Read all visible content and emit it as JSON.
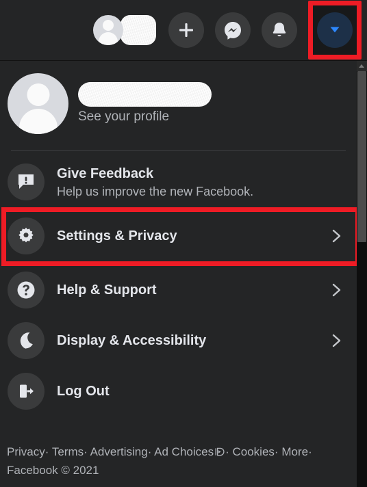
{
  "app": {
    "title": "Facebook account dropdown menu"
  },
  "topbar": {
    "profile_chip": {
      "name_redacted": true,
      "avatar": "user-avatar-icon"
    },
    "buttons": [
      {
        "name": "create-button",
        "icon": "plus-icon",
        "label": "Create"
      },
      {
        "name": "messenger-button",
        "icon": "messenger-icon",
        "label": "Messenger"
      },
      {
        "name": "notifications-button",
        "icon": "bell-icon",
        "label": "Notifications"
      },
      {
        "name": "account-dropdown-button",
        "icon": "chevron-down-triangle-icon",
        "label": "Account",
        "active": true,
        "highlighted": true
      }
    ]
  },
  "panel": {
    "profile": {
      "name_redacted": true,
      "see_profile_label": "See your profile",
      "avatar_icon": "user-avatar-icon"
    },
    "items": [
      {
        "id": "give-feedback",
        "icon": "feedback-bubble-icon",
        "title": "Give Feedback",
        "subtitle": "Help us improve the new Facebook.",
        "chevron": false,
        "highlighted": false
      },
      {
        "id": "settings-privacy",
        "icon": "gear-icon",
        "title": "Settings & Privacy",
        "subtitle": "",
        "chevron": true,
        "highlighted": true
      },
      {
        "id": "help-support",
        "icon": "question-mark-icon",
        "title": "Help & Support",
        "subtitle": "",
        "chevron": true,
        "highlighted": false
      },
      {
        "id": "display-accessibility",
        "icon": "moon-icon",
        "title": "Display & Accessibility",
        "subtitle": "",
        "chevron": true,
        "highlighted": false
      },
      {
        "id": "log-out",
        "icon": "logout-door-icon",
        "title": "Log Out",
        "subtitle": "",
        "chevron": false,
        "highlighted": false
      }
    ],
    "footer": {
      "links": [
        "Privacy",
        "Terms",
        "Advertising",
        "Ad Choices",
        "Cookies",
        "More"
      ],
      "separator": "·",
      "adchoices_icon": "adchoices-icon",
      "copyright": "Facebook © 2021"
    },
    "scrollbar": {
      "present": true,
      "arrow": "scroll-up-arrow-icon"
    }
  },
  "colors": {
    "panel_background": "#242526",
    "topbar_background": "#242526",
    "page_background": "#18191a",
    "icon_circle": "#3a3b3c",
    "primary_text": "#e4e6eb",
    "secondary_text": "#b0b3b8",
    "highlight_red": "#ee1c25",
    "accent_blue": "#2d88ff",
    "active_button_background": "#1d3048"
  }
}
